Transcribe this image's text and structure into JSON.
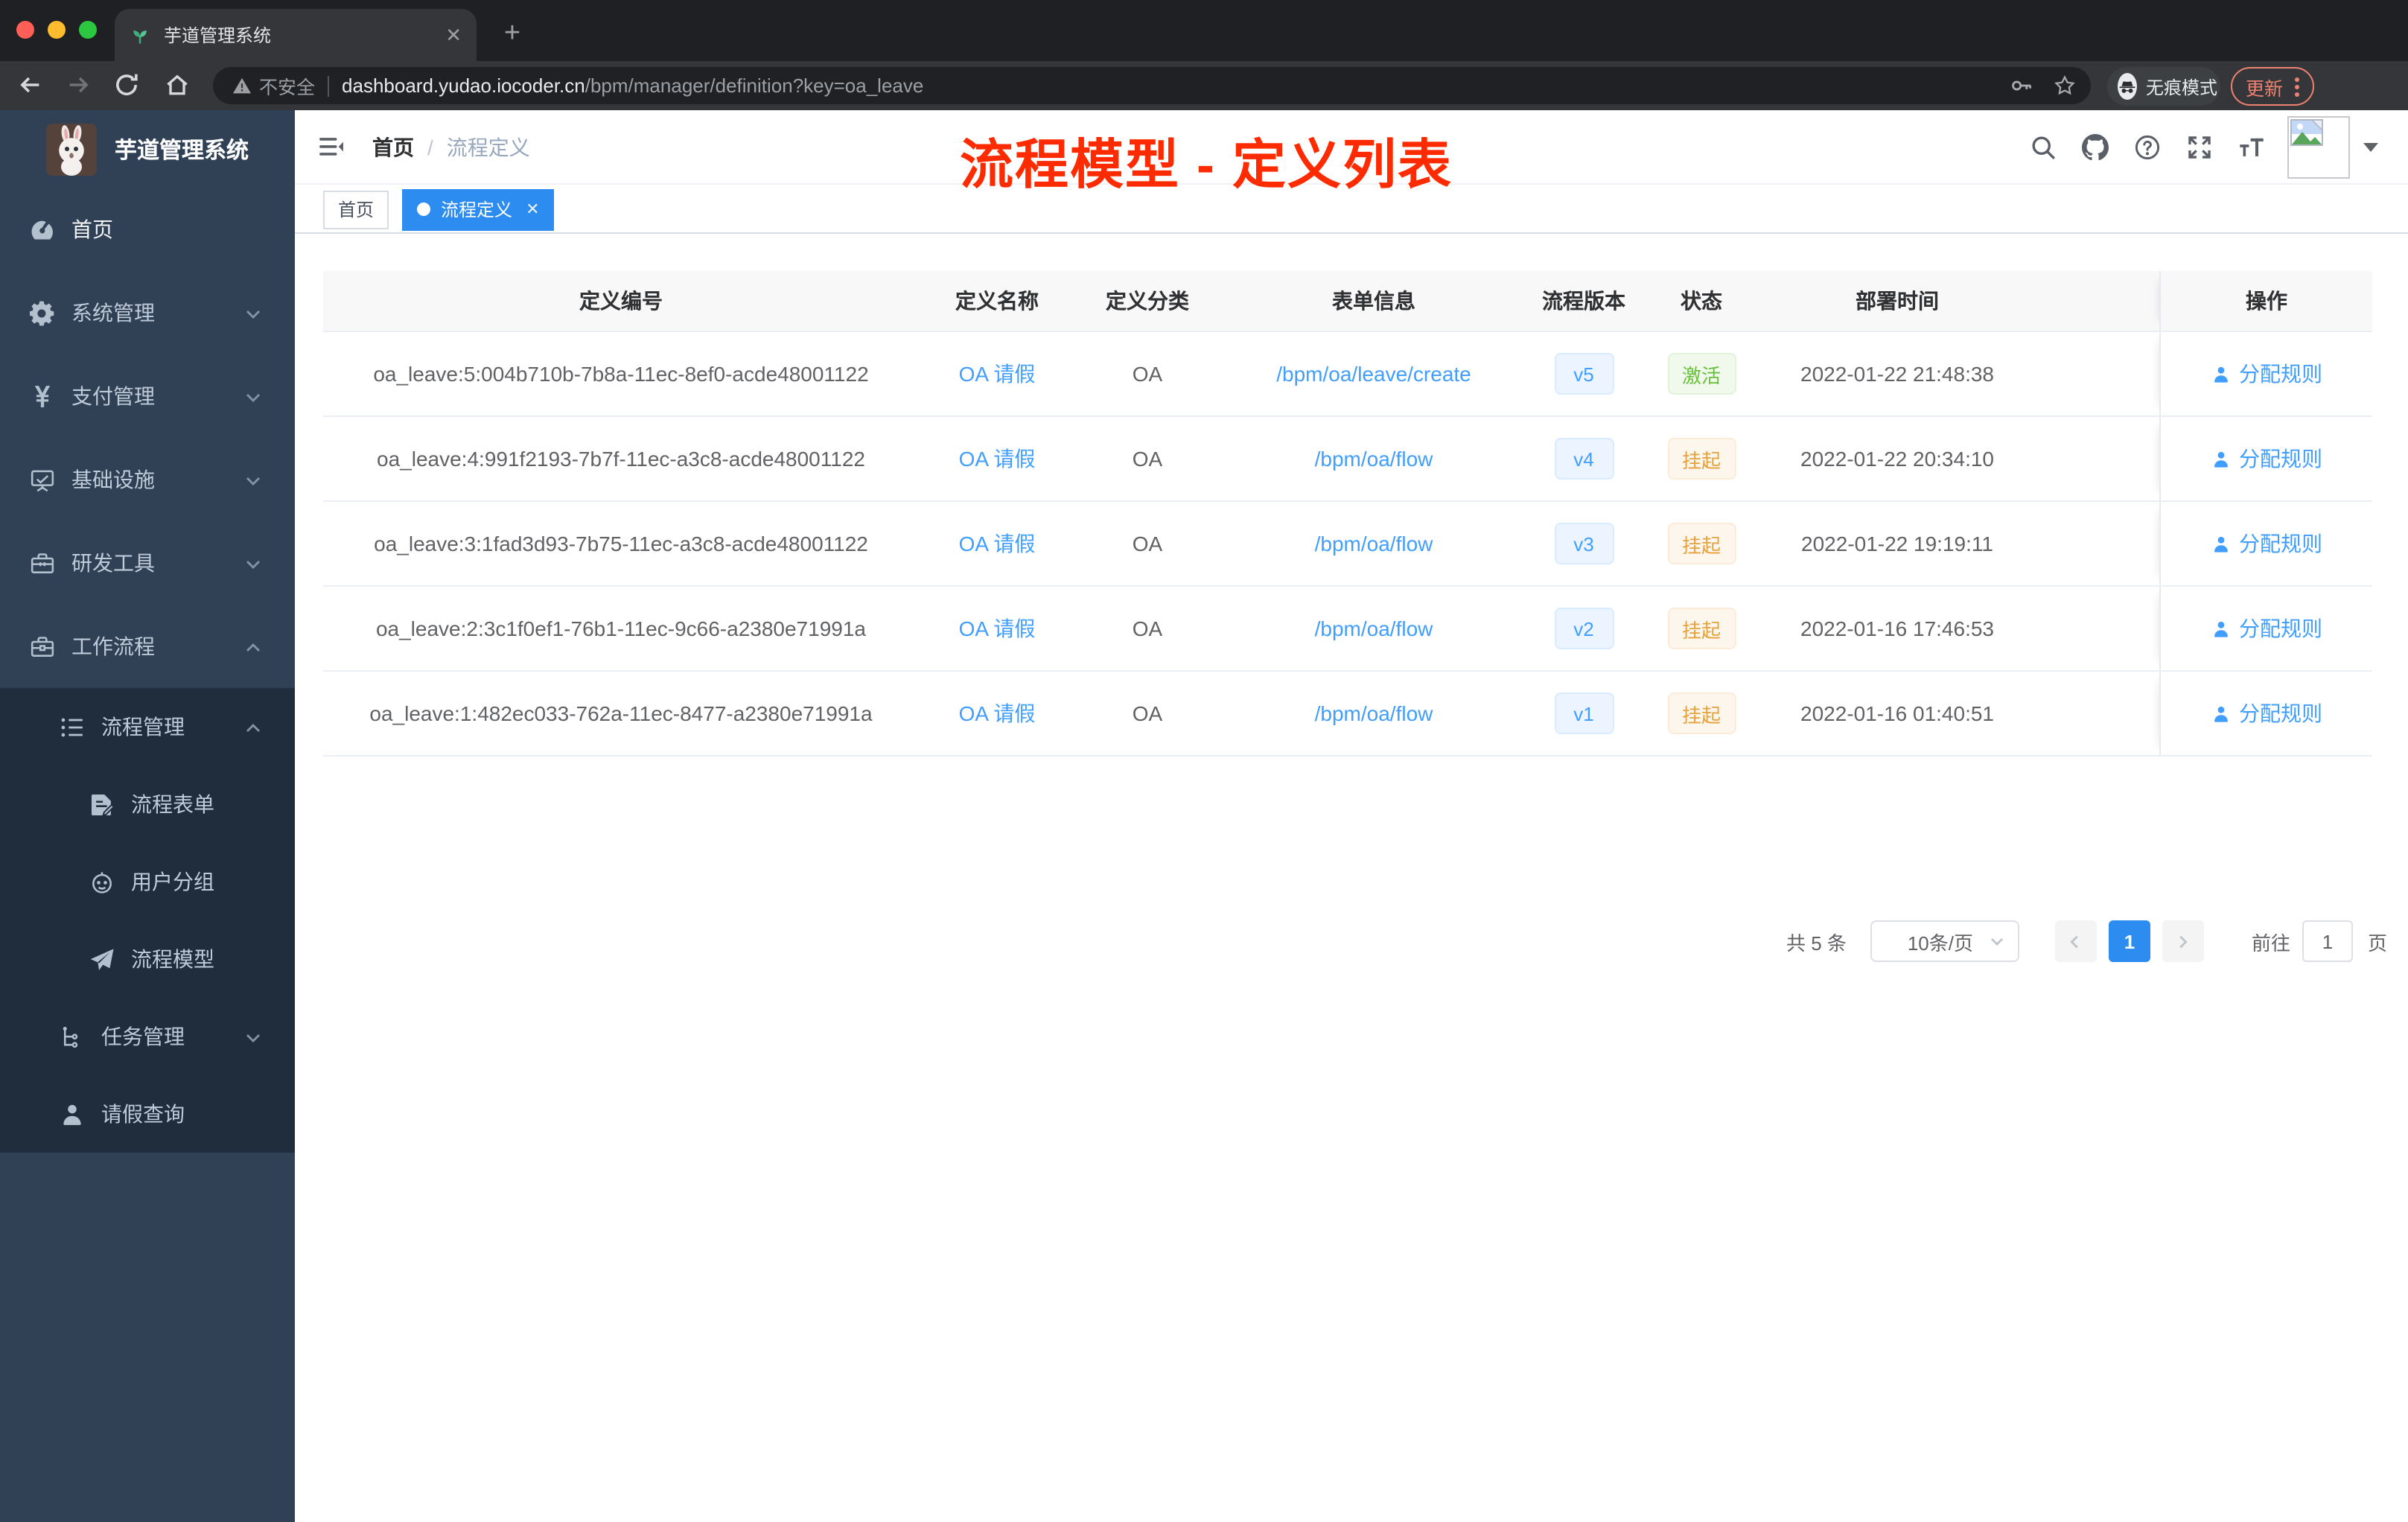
{
  "browser": {
    "tab": {
      "title": "芋道管理系统"
    },
    "toolbar": {
      "security": "不安全",
      "url_domain": "dashboard.yudao.iocoder.cn",
      "url_path": "/bpm/manager/definition?key=oa_leave",
      "incognito": "无痕模式",
      "update": "更新"
    }
  },
  "sidebar": {
    "title": "芋道管理系统",
    "items": [
      {
        "icon": "dashboard-icon",
        "label": "首页",
        "bright": true
      },
      {
        "icon": "gear-icon",
        "label": "系统管理",
        "chevron": "down"
      },
      {
        "icon": "yen-icon",
        "label": "支付管理",
        "chevron": "down"
      },
      {
        "icon": "monitor-icon",
        "label": "基础设施",
        "chevron": "down"
      },
      {
        "icon": "toolbox-icon",
        "label": "研发工具",
        "chevron": "down"
      },
      {
        "icon": "briefcase-icon",
        "label": "工作流程",
        "chevron": "up",
        "children": [
          {
            "icon": "list-icon",
            "label": "流程管理",
            "chevron": "up",
            "children": [
              {
                "icon": "form-icon",
                "label": "流程表单"
              },
              {
                "icon": "robot-icon",
                "label": "用户分组"
              },
              {
                "icon": "plane-icon",
                "label": "流程模型"
              }
            ]
          },
          {
            "icon": "tree-icon",
            "label": "任务管理",
            "chevron": "down"
          },
          {
            "icon": "user-icon",
            "label": "请假查询"
          }
        ]
      }
    ]
  },
  "navbar": {
    "breadcrumb": {
      "home": "首页",
      "sep": "/",
      "current": "流程定义"
    }
  },
  "annotation": {
    "text": "流程模型 - 定义列表",
    "color": "#fe2b00"
  },
  "tags": {
    "items": [
      {
        "label": "首页",
        "active": false
      },
      {
        "label": "流程定义",
        "active": true,
        "closable": true
      }
    ]
  },
  "table": {
    "columns": [
      "定义编号",
      "定义名称",
      "定义分类",
      "表单信息",
      "流程版本",
      "状态",
      "部署时间",
      "操作"
    ],
    "action_label": "分配规则",
    "rows": [
      {
        "id": "oa_leave:5:004b710b-7b8a-11ec-8ef0-acde48001122",
        "name": "OA 请假",
        "category": "OA",
        "form": "/bpm/oa/leave/create",
        "version": "v5",
        "status": "激活",
        "status_type": "success",
        "time": "2022-01-22 21:48:38"
      },
      {
        "id": "oa_leave:4:991f2193-7b7f-11ec-a3c8-acde48001122",
        "name": "OA 请假",
        "category": "OA",
        "form": "/bpm/oa/flow",
        "version": "v4",
        "status": "挂起",
        "status_type": "warning",
        "time": "2022-01-22 20:34:10"
      },
      {
        "id": "oa_leave:3:1fad3d93-7b75-11ec-a3c8-acde48001122",
        "name": "OA 请假",
        "category": "OA",
        "form": "/bpm/oa/flow",
        "version": "v3",
        "status": "挂起",
        "status_type": "warning",
        "time": "2022-01-22 19:19:11"
      },
      {
        "id": "oa_leave:2:3c1f0ef1-76b1-11ec-9c66-a2380e71991a",
        "name": "OA 请假",
        "category": "OA",
        "form": "/bpm/oa/flow",
        "version": "v2",
        "status": "挂起",
        "status_type": "warning",
        "time": "2022-01-16 17:46:53"
      },
      {
        "id": "oa_leave:1:482ec033-762a-11ec-8477-a2380e71991a",
        "name": "OA 请假",
        "category": "OA",
        "form": "/bpm/oa/flow",
        "version": "v1",
        "status": "挂起",
        "status_type": "warning",
        "time": "2022-01-16 01:40:51"
      }
    ]
  },
  "pagination": {
    "total": "共 5 条",
    "page_size": "10条/页",
    "current_page": "1",
    "goto_label": "前往",
    "page_unit": "页"
  },
  "colors": {
    "accent": "#409eff",
    "tag_active": "#2d8cf0",
    "success": "#67c23a",
    "warning": "#e6a23c",
    "sidebar": "#304156",
    "submenu": "#1f2d3d",
    "annotation": "#fe2b00"
  }
}
